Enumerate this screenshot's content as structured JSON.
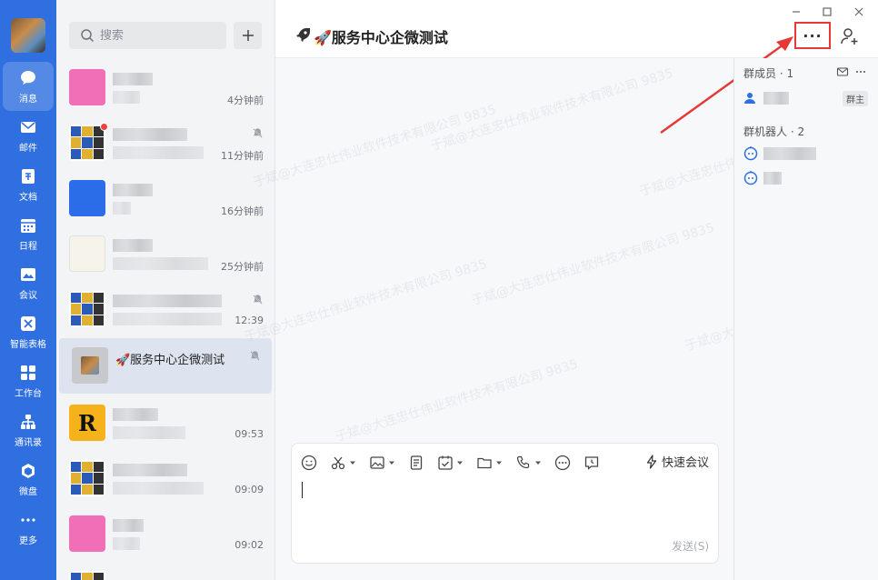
{
  "nav": {
    "items": [
      {
        "label": "消息",
        "icon": "chat-bubble-icon"
      },
      {
        "label": "邮件",
        "icon": "mail-icon"
      },
      {
        "label": "文档",
        "icon": "document-icon"
      },
      {
        "label": "日程",
        "icon": "calendar-icon"
      },
      {
        "label": "会议",
        "icon": "meeting-icon"
      },
      {
        "label": "智能表格",
        "icon": "smart-sheet-icon"
      },
      {
        "label": "工作台",
        "icon": "workbench-icon"
      },
      {
        "label": "通讯录",
        "icon": "contacts-icon"
      },
      {
        "label": "微盘",
        "icon": "cloud-drive-icon"
      },
      {
        "label": "更多",
        "icon": "more-icon"
      }
    ]
  },
  "search": {
    "placeholder": "搜索"
  },
  "conversations": [
    {
      "time": "4分钟前"
    },
    {
      "time": "11分钟前"
    },
    {
      "time": "16分钟前"
    },
    {
      "time": "25分钟前"
    },
    {
      "time": "12:39"
    },
    {
      "title": "🚀服务中心企微测试"
    },
    {
      "time": "09:53"
    },
    {
      "time": "09:09"
    },
    {
      "time": "09:02"
    }
  ],
  "chat": {
    "title": "🚀服务中心企微测试",
    "more_label": "···"
  },
  "members_panel": {
    "group_members_label": "群成员 · 1",
    "owner_badge": "群主",
    "bots_label": "群机器人 · 2"
  },
  "watermark": "于斌@大连忠仕伟业软件技术有限公司 9835",
  "compose": {
    "quick_meeting": "快速会议",
    "send": "发送(S)"
  },
  "colors": {
    "rail": "#2f6fe0",
    "highlight": "#e53935"
  }
}
